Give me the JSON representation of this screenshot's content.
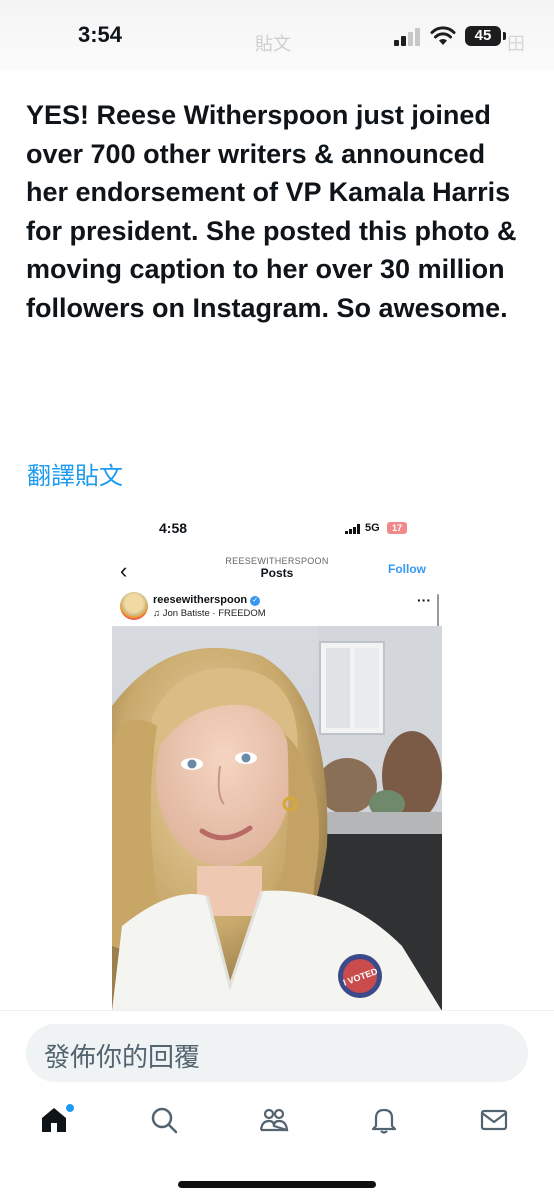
{
  "status_bar": {
    "time": "3:54",
    "battery": "45",
    "ghost_left": "貼文",
    "ghost_right": "田"
  },
  "tweet": {
    "text": "YES! Reese Witherspoon just joined over 700 other writers & announced her endorsement of VP Kamala Harris for president. She posted this photo & moving caption to her over 30 million followers on Instagram. So awesome.",
    "translate_label": "翻譯貼文"
  },
  "embedded_screenshot": {
    "time": "4:58",
    "network": "5G",
    "battery": "17",
    "header_small": "REESEWITHERSPOON",
    "header_title": "Posts",
    "follow_label": "Follow",
    "username": "reesewitherspoon",
    "audio": "Jon Batiste · FREEDOM",
    "more": "···",
    "back": "‹",
    "sticker_text": "I VOTED"
  },
  "reply": {
    "placeholder": "發佈你的回覆"
  },
  "tabs": [
    {
      "icon": "home-icon"
    },
    {
      "icon": "search-icon"
    },
    {
      "icon": "communities-icon"
    },
    {
      "icon": "notifications-icon"
    },
    {
      "icon": "messages-icon"
    }
  ],
  "colors": {
    "accent": "#1d9bf0",
    "text": "#0f1419",
    "ig_blue": "#3897f0"
  }
}
